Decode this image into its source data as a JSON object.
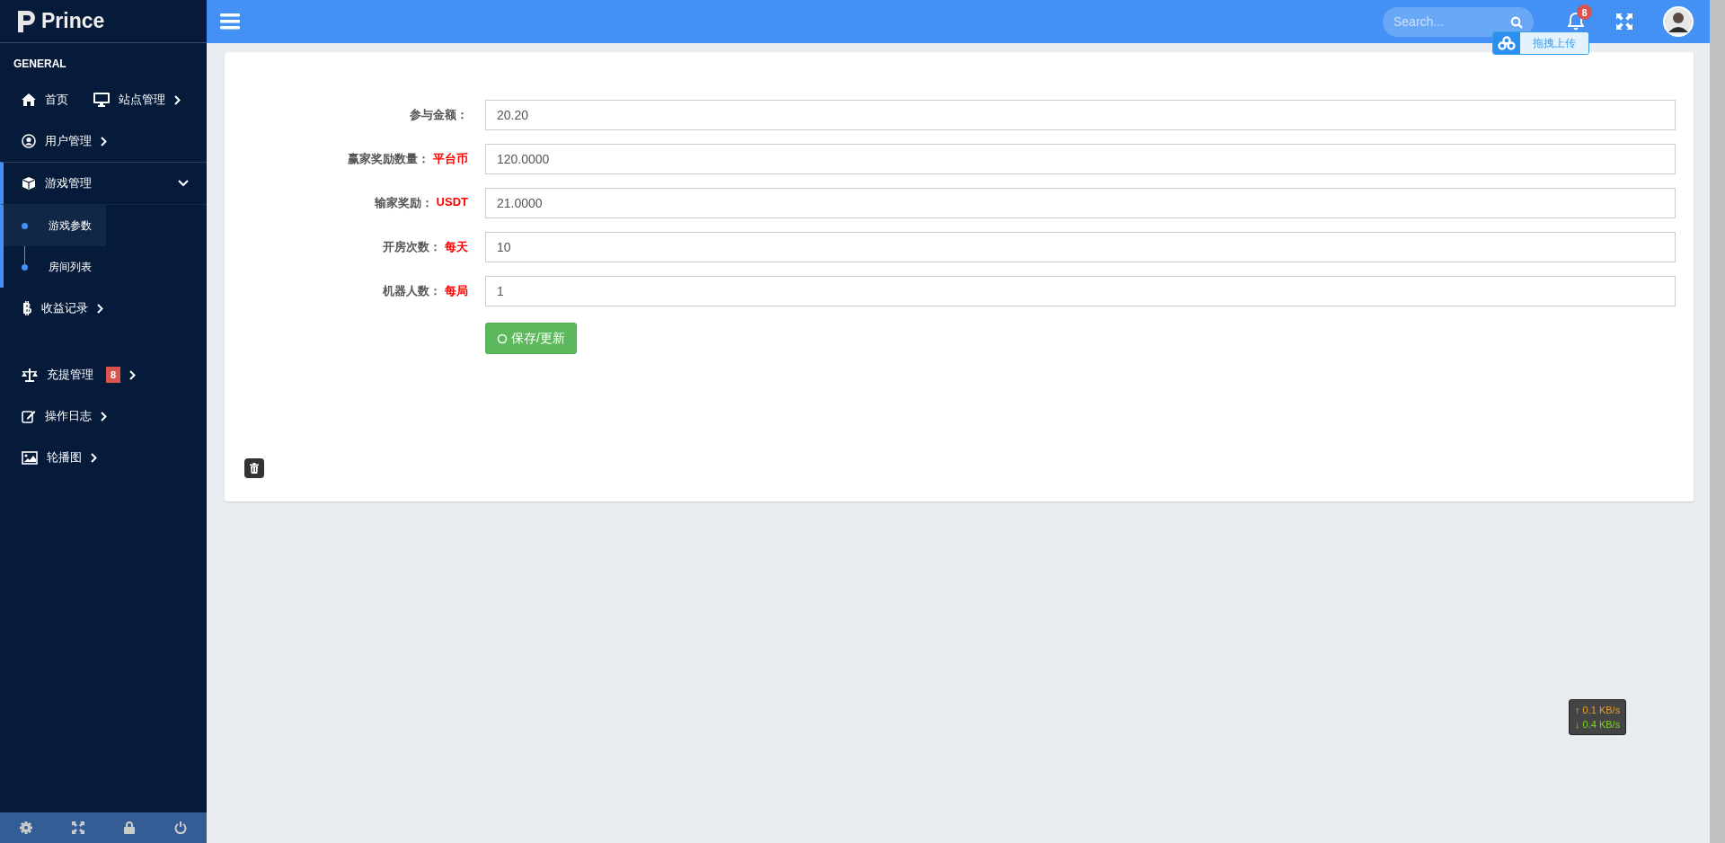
{
  "brand": "Prince",
  "sidebar": {
    "section": "GENERAL",
    "rows": [
      {
        "items": [
          {
            "label": "首页"
          },
          {
            "label": "站点管理",
            "expanded": false
          }
        ]
      },
      {
        "items": [
          {
            "label": "用户管理",
            "expanded": false
          }
        ]
      },
      {
        "items": [
          {
            "label": "游戏管理",
            "expanded": true,
            "selected": true,
            "children": [
              {
                "label": "游戏参数",
                "selected": true
              },
              {
                "label": "房间列表",
                "selected": false
              }
            ]
          }
        ]
      },
      {
        "items": [
          {
            "label": "收益记录",
            "expanded": false
          }
        ]
      },
      {
        "items": [
          {
            "label": "充提管理",
            "expanded": false,
            "badge": "8"
          }
        ]
      },
      {
        "items": [
          {
            "label": "操作日志",
            "expanded": false
          }
        ]
      },
      {
        "items": [
          {
            "label": "轮播图",
            "expanded": false
          }
        ]
      }
    ]
  },
  "topbar": {
    "search": {
      "placeholder": "Search..."
    },
    "notification_badge": "8",
    "upload_tip": "拖拽上传"
  },
  "form": {
    "fields": [
      {
        "label": "参与金额：",
        "value": "20.20"
      },
      {
        "label": "赢家奖励数量：",
        "unit": "平台币",
        "value": "120.0000"
      },
      {
        "label": "输家奖励：",
        "unit": "USDT",
        "value": "21.0000"
      },
      {
        "label": "开房次数：",
        "unit": "每天",
        "value": "10"
      },
      {
        "label": "机器人数：",
        "unit": "每局",
        "value": "1"
      }
    ],
    "save_button": "保存/更新"
  },
  "speed": {
    "up": "↑ 0.1 KB/s",
    "down": "↓ 0.4 KB/s"
  }
}
